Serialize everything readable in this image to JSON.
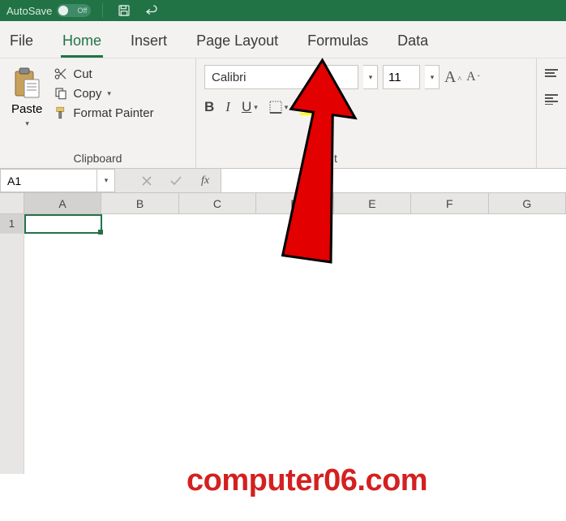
{
  "titlebar": {
    "autosave_label": "AutoSave",
    "toggle_state": "Off"
  },
  "tabs": {
    "file": "File",
    "home": "Home",
    "insert": "Insert",
    "page_layout": "Page Layout",
    "formulas": "Formulas",
    "data": "Data"
  },
  "clipboard": {
    "paste": "Paste",
    "cut": "Cut",
    "copy": "Copy",
    "format_painter": "Format Painter",
    "group_label": "Clipboard"
  },
  "font": {
    "name": "Calibri",
    "size": "11",
    "bold": "B",
    "italic": "I",
    "underline": "U",
    "group_label_fragment": "t",
    "fill_color": "#ffff00",
    "font_color": "#c00000"
  },
  "namebox": {
    "value": "A1"
  },
  "columns": [
    "A",
    "B",
    "C",
    "D",
    "E",
    "F",
    "G"
  ],
  "rows": [
    "1"
  ],
  "watermark": "computer06.com"
}
